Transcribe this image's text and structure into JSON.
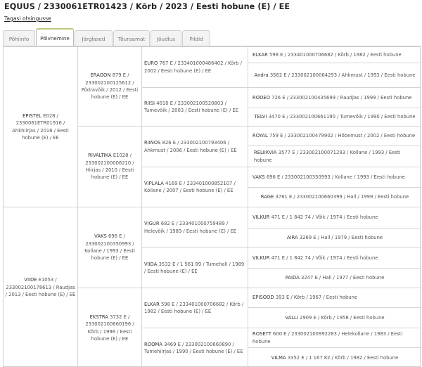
{
  "header": {
    "title": "EQUUS / 2330061ETR01423 / Kõrb / 2023 / Eesti hobune (E) / EE",
    "back_link": "Tagasi otsingusse"
  },
  "tabs": [
    {
      "label": "Põhiinfo",
      "active": false
    },
    {
      "label": "Põlvnemine",
      "active": true
    },
    {
      "label": "Järglased",
      "active": false
    },
    {
      "label": "Tõuraamat",
      "active": false
    },
    {
      "label": "Jõudlus",
      "active": false
    },
    {
      "label": "Pildid",
      "active": false
    }
  ],
  "pedigree": {
    "gen1": [
      {
        "name": "EPISTEL",
        "details": "E028 / 2330061ETR01916 / Ahkhiirjas / 2016 / Eesti hobune (E) / EE"
      },
      {
        "name": "VIIDE",
        "details": "E1053 / 233002100178613 / Raudjas / 2013 / Eesti hobune (E) / EE"
      }
    ],
    "gen2": [
      {
        "name": "ERAGON",
        "details": "879 E / 233002100125612 / Põdravõik / 2012 / Eesti hobune (E) / EE"
      },
      {
        "name": "RIVALTIKA",
        "details": "E1028 / 233002100006210 / Hiirjas / 2010 / Eesti hobune (E) / EE"
      },
      {
        "name": "VAKS",
        "details": "696 E / 233002100350993 / Kollane / 1993 / Eesti hobune (E) / EE"
      },
      {
        "name": "EKSTRA",
        "details": "3732 E / 233002100660196 / Kõrb / 1996 / Eesti hobune (E) / EE"
      }
    ],
    "gen3": [
      {
        "name": "EURO",
        "details": "767 E / 233401000486402 / Kõrb / 2002 / Eesti hobune (E) / EE"
      },
      {
        "name": "RIISI",
        "details": "4010 E / 233002100520803 / Tumevõik / 2003 / Eesti hobune (E) / EE"
      },
      {
        "name": "RIINOS",
        "details": "826 E / 233002100793406 / Ahkmust / 2006 / Eesti hobune (E) / EE"
      },
      {
        "name": "VIPLALA",
        "details": "4169 E / 233401000852107 / Kollane / 2007 / Eesti hobune (E) / EE"
      },
      {
        "name": "VIGUR",
        "details": "682 E / 233401000759489 / Helevõik / 1989 / Eesti hobune (E) / EE"
      },
      {
        "name": "VIIDA",
        "details": "3532 E / 1 561 89 / Tumehall / 1989 / Eesti hobune (E) / EE"
      },
      {
        "name": "ELKAR",
        "details": "598 E / 233401000706682 / Kõrb / 1982 / Eesti hobune (E) / EE"
      },
      {
        "name": "ROOMA",
        "details": "3469 E / 233002100660890 / Tumehiirjas / 1990 / Eesti hobune (E) / EE"
      }
    ],
    "gen4": [
      {
        "name": "ELKAR",
        "details": "598 E / 233401000706682 / Kõrb / 1982 / Eesti hobune"
      },
      {
        "name": "Andra",
        "details": "3562 E / 233002100064293 / Ahkmust / 1993 / Eesti hobune"
      },
      {
        "name": "RODEO",
        "details": "726 E / 233002100435699 / Raudjas / 1999 / Eesti hobune"
      },
      {
        "name": "TELVI",
        "details": "3470 E / 233002100661190 / Tumevõik / 1990 / Eesti hobune"
      },
      {
        "name": "ROYAL",
        "details": "759 E / 233002100479902 / Hõbemust / 2002 / Eesti hobune"
      },
      {
        "name": "RELIIKVIA",
        "details": "3577 E / 233002100071293 / Kollane / 1993 / Eesti hobune"
      },
      {
        "name": "VAKS",
        "details": "696 E / 233002100350993 / Kollane / 1993 / Eesti hobune"
      },
      {
        "name": "RAGE",
        "details": "3781 E / 233002100660399 / Hall / 1999 / Eesti hobune"
      },
      {
        "name": "VILKUR",
        "details": "471 E / 1 842 74 / Võik / 1974 / Eesti hobune"
      },
      {
        "name": "AIRA",
        "details": "3269 E / Hall / 1979 / Eesti hobune"
      },
      {
        "name": "VILKUR",
        "details": "471 E / 1 842 74 / Võik / 1974 / Eesti hobune"
      },
      {
        "name": "PAIDA",
        "details": "3247 E / Hall / 1977 / Eesti hobune"
      },
      {
        "name": "EPISOOD",
        "details": "393 E / Kõrb / 1967 / Eesti hobune"
      },
      {
        "name": "VALLI",
        "details": "2909 E / Kõrb / 1958 / Eesti hobune"
      },
      {
        "name": "ROSETT",
        "details": "600 E / 233002100992283 / Helekollane / 1983 / Eesti hobune"
      },
      {
        "name": "VILMA",
        "details": "3352 E / 1 167 82 / Kõrb / 1982 / Eesti hobune"
      }
    ]
  }
}
